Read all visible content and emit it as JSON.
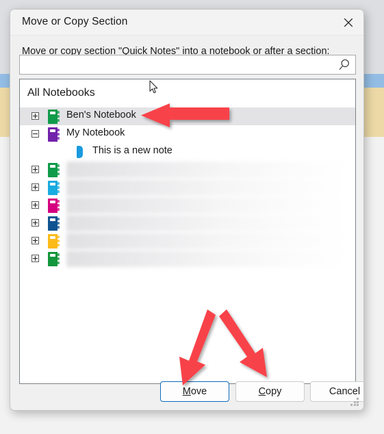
{
  "window": {
    "title": "Move or Copy Section",
    "close_icon": "close-icon"
  },
  "prompt": {
    "before": "Move or copy section \"Quick Notes\" in",
    "accel": "t",
    "after": "o a notebook or after a section:"
  },
  "search": {
    "value": "",
    "placeholder": "",
    "icon": "search-icon"
  },
  "tree": {
    "header": "All Notebooks",
    "rows": [
      {
        "label": "Ben's Notebook",
        "icon": "notebook-icon",
        "color": "#0f9b4a",
        "expander": "plus",
        "indent": 0,
        "selected": true,
        "redacted": false
      },
      {
        "label": "My Notebook",
        "icon": "notebook-icon",
        "color": "#7322ab",
        "expander": "minus",
        "indent": 0,
        "selected": false,
        "redacted": false
      },
      {
        "label": "This is a new note",
        "icon": "section-tab-icon",
        "color": "#1a9adf",
        "expander": "none",
        "indent": 1,
        "selected": false,
        "redacted": false
      },
      {
        "label": "",
        "icon": "notebook-icon",
        "color": "#0f9b4a",
        "expander": "plus",
        "indent": 0,
        "selected": false,
        "redacted": true
      },
      {
        "label": "",
        "icon": "notebook-icon",
        "color": "#19ace0",
        "expander": "plus",
        "indent": 0,
        "selected": false,
        "redacted": true
      },
      {
        "label": "",
        "icon": "notebook-icon",
        "color": "#d5007f",
        "expander": "plus",
        "indent": 0,
        "selected": false,
        "redacted": true
      },
      {
        "label": "",
        "icon": "notebook-icon",
        "color": "#0f5490",
        "expander": "plus",
        "indent": 0,
        "selected": false,
        "redacted": true
      },
      {
        "label": "",
        "icon": "notebook-icon",
        "color": "#fcbb18",
        "expander": "plus",
        "indent": 0,
        "selected": false,
        "redacted": true
      },
      {
        "label": "",
        "icon": "notebook-icon",
        "color": "#14963c",
        "expander": "plus",
        "indent": 0,
        "selected": false,
        "redacted": true
      }
    ]
  },
  "buttons": {
    "move": {
      "accel": "M",
      "rest": "ove",
      "default": true
    },
    "copy": {
      "accel": "C",
      "rest": "opy",
      "default": false
    },
    "cancel": {
      "label": "Cancel",
      "default": false
    }
  },
  "annotations": {
    "arrow_color": "#f8434a",
    "arrows": [
      {
        "name": "arrow-to-bens-notebook",
        "direction": "left"
      },
      {
        "name": "arrow-to-move-button",
        "direction": "down-left"
      },
      {
        "name": "arrow-to-copy-button",
        "direction": "down-right"
      }
    ]
  },
  "colors": {
    "accent": "#0e6cbd",
    "selection": "#e3e3e6",
    "dialog_bg": "#f0f0f0"
  }
}
